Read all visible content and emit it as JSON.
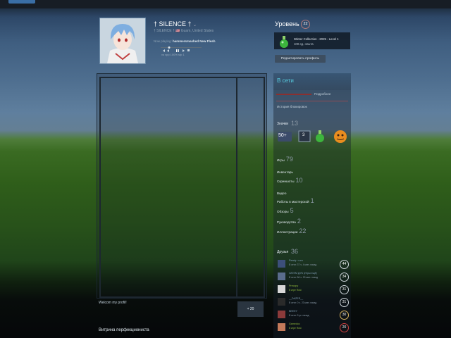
{
  "profile": {
    "name": "† SILENCE †",
    "name_chevron": "⌄",
    "subline": "† SILENCE †   🇺🇸 Guam, United States",
    "now_playing_label": "Now playing:",
    "now_playing_track": "hammersmashed New Flesh",
    "player_controls": "vs   vpp   100%   stp   1"
  },
  "level": {
    "title": "Уровень",
    "value": "22",
    "badge_line1": "Winter Collection - 2025 - Level 1",
    "badge_line2": "100 ед. опыта",
    "edit_button": "Редактировать профиль"
  },
  "main": {
    "welcome": "Welcom my profil!",
    "plus_button": "+ 20",
    "showcase_title": "Витрина перфекциониста"
  },
  "sidebar": {
    "online": "В сети",
    "more": "Подробнее",
    "ban_history": "История блокировок",
    "badges_label": "Значки",
    "badges_count": "13",
    "badge_items": [
      "50+",
      "3"
    ],
    "stats": [
      {
        "label": "Игры",
        "count": "79"
      },
      {
        "label": "Инвентарь",
        "count": ""
      },
      {
        "label": "Скриншоты",
        "count": "10"
      },
      {
        "label": "Видео",
        "count": ""
      },
      {
        "label": "Работы в мастерской",
        "count": "1"
      },
      {
        "label": "Обзоры",
        "count": "5"
      },
      {
        "label": "Руководства",
        "count": "2"
      },
      {
        "label": "Иллюстрации",
        "count": "22"
      }
    ],
    "friends_label": "Друзья",
    "friends_count": "36",
    "friends": [
      {
        "name": "Ready ~ruru",
        "status": "В сети: 37 ч. 4 мин. назад",
        "level": "44",
        "color": "#3c4f7a"
      },
      {
        "name": "ЗАТЕМ ДУБ (Игры ещё)",
        "status": "В сети: 56 ч. 29 мин. назад",
        "level": "34",
        "color": "#5a6c8c"
      },
      {
        "name": "Precopy",
        "status": "В игре\nRust",
        "level": "31",
        "color": "#d8d8d8"
      },
      {
        "name": "__DAZER__",
        "status": "В сети: 0 ч. 23 мин. назад",
        "level": "31",
        "color": "#2a2a2a"
      },
      {
        "name": "BEEEY",
        "status": "В сети: 9 ус. назад",
        "level": "30",
        "color": "#8b3a3a"
      },
      {
        "name": "Gamedoc",
        "status": "В игре\nRust",
        "level": "20",
        "color": "#c47a5a"
      }
    ]
  }
}
